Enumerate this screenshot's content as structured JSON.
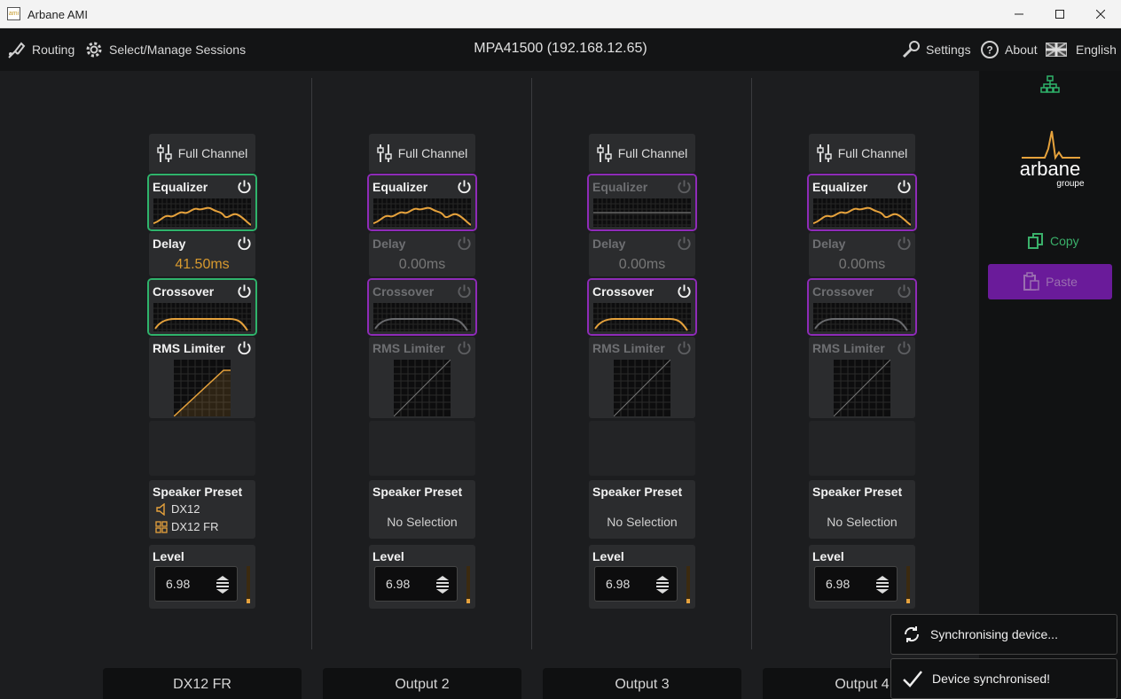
{
  "window": {
    "icon_text": "ami",
    "title": "Arbane AMI"
  },
  "nav": {
    "routing": "Routing",
    "sessions": "Select/Manage Sessions",
    "device": "MPA41500 (192.168.12.65)",
    "settings": "Settings",
    "about": "About",
    "language": "English"
  },
  "channels": [
    {
      "full_channel": "Full Channel",
      "eq_label": "Equalizer",
      "eq_enabled": true,
      "delay_label": "Delay",
      "delay_value": "41.50ms",
      "delay_enabled": true,
      "crossover_label": "Crossover",
      "crossover_enabled": true,
      "rms_label": "RMS Limiter",
      "rms_enabled": true,
      "preset_label": "Speaker Preset",
      "preset_speaker": "DX12",
      "preset_config": "DX12 FR",
      "level_label": "Level",
      "level_value": "6.98",
      "output_name": "DX12 FR"
    },
    {
      "full_channel": "Full Channel",
      "eq_label": "Equalizer",
      "eq_enabled": true,
      "delay_label": "Delay",
      "delay_value": "0.00ms",
      "delay_enabled": false,
      "crossover_label": "Crossover",
      "crossover_enabled": false,
      "rms_label": "RMS Limiter",
      "rms_enabled": false,
      "preset_label": "Speaker Preset",
      "preset_none": "No Selection",
      "level_label": "Level",
      "level_value": "6.98",
      "output_name": "Output 2"
    },
    {
      "full_channel": "Full Channel",
      "eq_label": "Equalizer",
      "eq_enabled": false,
      "delay_label": "Delay",
      "delay_value": "0.00ms",
      "delay_enabled": false,
      "crossover_label": "Crossover",
      "crossover_enabled": true,
      "rms_label": "RMS Limiter",
      "rms_enabled": false,
      "preset_label": "Speaker Preset",
      "preset_none": "No Selection",
      "level_label": "Level",
      "level_value": "6.98",
      "output_name": "Output 3"
    },
    {
      "full_channel": "Full Channel",
      "eq_label": "Equalizer",
      "eq_enabled": true,
      "delay_label": "Delay",
      "delay_value": "0.00ms",
      "delay_enabled": false,
      "crossover_label": "Crossover",
      "crossover_enabled": false,
      "rms_label": "RMS Limiter",
      "rms_enabled": false,
      "preset_label": "Speaker Preset",
      "preset_none": "No Selection",
      "level_label": "Level",
      "level_value": "6.98",
      "output_name": "Output 4"
    }
  ],
  "sidebar": {
    "brand": "arbane",
    "brand_sub": "groupe",
    "copy": "Copy",
    "paste": "Paste"
  },
  "toasts": {
    "syncing": "Synchronising device...",
    "synced": "Device synchronised!"
  },
  "colors": {
    "accent_orange": "#e6a23c",
    "selected_green": "#2fb36b",
    "selected_purple": "#8e2bb8",
    "paste_purple": "#6a1b9a"
  },
  "icons": [
    "routing-icon",
    "gear-icon",
    "wrench-icon",
    "help-icon",
    "language-flag-icon",
    "network-icon",
    "copy-icon",
    "paste-icon",
    "power-icon",
    "sliders-icon",
    "speaker-icon",
    "config-icon",
    "stepper-icon",
    "sync-icon",
    "check-icon"
  ]
}
